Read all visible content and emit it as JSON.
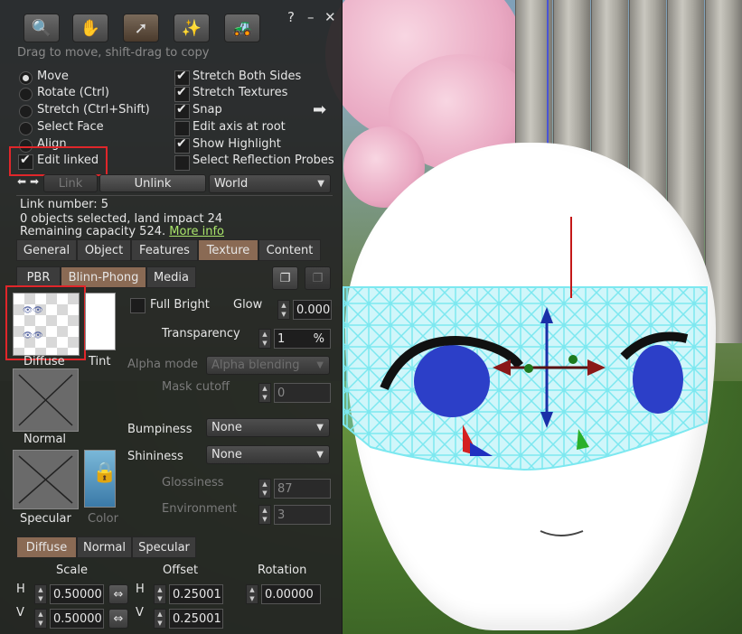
{
  "floater": {
    "hint": "Drag to move, shift-drag to copy",
    "tools": [
      {
        "name": "focus-tool",
        "icon": "magnifier-icon"
      },
      {
        "name": "move-tool",
        "icon": "hand-icon"
      },
      {
        "name": "edit-tool",
        "icon": "arrow-icon"
      },
      {
        "name": "create-tool",
        "icon": "wand-icon"
      },
      {
        "name": "land-tool",
        "icon": "bulldozer-icon"
      }
    ],
    "header_icons": {
      "help": "?",
      "minimize": "–",
      "close": "✕"
    },
    "modes": [
      "Move",
      "Rotate (Ctrl)",
      "Stretch (Ctrl+Shift)",
      "Select Face",
      "Align"
    ],
    "selected_mode": "Move",
    "edit_linked": "Edit linked",
    "options": [
      {
        "label": "Stretch Both Sides",
        "checked": true
      },
      {
        "label": "Stretch Textures",
        "checked": true
      },
      {
        "label": "Snap",
        "checked": true
      },
      {
        "label": "Edit axis at root",
        "checked": false
      },
      {
        "label": "Show Highlight",
        "checked": true
      },
      {
        "label": "Select Reflection Probes",
        "checked": false
      }
    ],
    "link_label": "Link",
    "unlink_label": "Unlink",
    "ruler": "World",
    "link_number": "Link number: 5",
    "selection_info": "0 objects selected, land impact 24",
    "capacity": "Remaining capacity 524.",
    "more_info": "More info",
    "tabs": [
      "General",
      "Object",
      "Features",
      "Texture",
      "Content"
    ],
    "selected_tab": "Texture"
  },
  "texture": {
    "material_tabs": [
      "PBR",
      "Blinn-Phong",
      "Media"
    ],
    "selected_material_tab": "Blinn-Phong",
    "diffuse_label": "Diffuse",
    "tint_label": "Tint",
    "normal_label": "Normal",
    "specular_label": "Specular",
    "color_label": "Color",
    "full_bright": "Full Bright",
    "glow_label": "Glow",
    "glow_value": "0.000",
    "transparency_label": "Transparency",
    "transparency_value": "1",
    "transparency_unit": "%",
    "alpha_mode_label": "Alpha mode",
    "alpha_mode_value": "Alpha blending",
    "mask_cutoff_label": "Mask cutoff",
    "mask_cutoff_value": "0",
    "bumpiness_label": "Bumpiness",
    "bumpiness_value": "None",
    "shininess_label": "Shininess",
    "shininess_value": "None",
    "glossiness_label": "Glossiness",
    "glossiness_value": "87",
    "environment_label": "Environment",
    "environment_value": "3",
    "map_tabs": [
      "Diffuse",
      "Normal",
      "Specular"
    ],
    "selected_map_tab": "Diffuse",
    "scale_label": "Scale",
    "offset_label": "Offset",
    "rotation_label": "Rotation",
    "h_label": "H",
    "v_label": "V",
    "scale_h": "0.50000",
    "scale_v": "0.50000",
    "offset_h": "0.25001",
    "offset_v": "0.25001",
    "rotation_value": "0.00000"
  },
  "colors": {
    "selected_tab": "#8a6a54",
    "highlight_box": "#e0262a",
    "link": "#a9e46a"
  }
}
